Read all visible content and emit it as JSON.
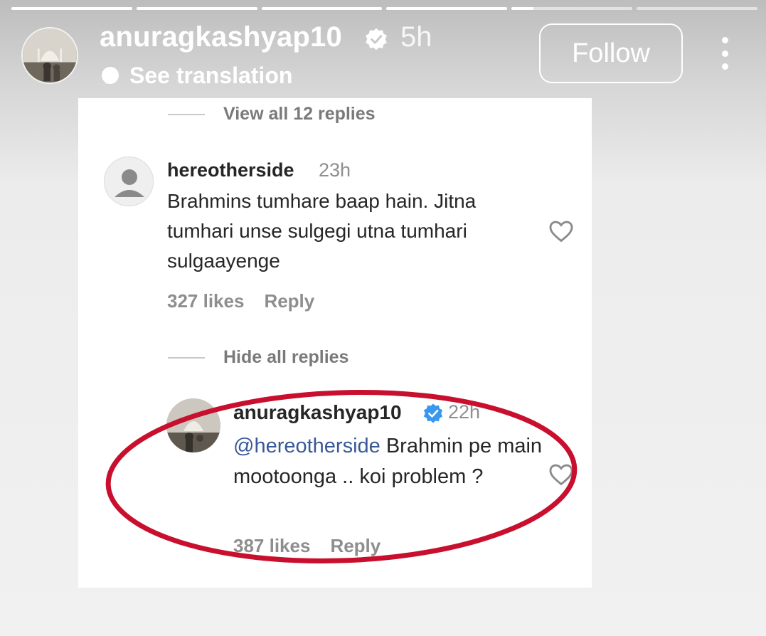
{
  "story": {
    "progress": [
      1,
      1,
      1,
      1,
      0.18,
      0
    ],
    "header": {
      "username": "anuragkashyap10",
      "time": "5h",
      "translation": "See translation",
      "follow_label": "Follow"
    }
  },
  "screenshot": {
    "view_replies": "View all 12 replies",
    "comment1": {
      "username": "hereotherside",
      "time": "23h",
      "text": "Brahmins tumhare baap hain. Jitna tumhari unse sulgegi utna tumhari sulgaayenge",
      "likes": "327 likes",
      "reply": "Reply"
    },
    "hide_replies": "Hide all replies",
    "comment2": {
      "username": "anuragkashyap10",
      "time": "22h",
      "mention": "@hereotherside",
      "text": " Brahmin pe main mootoonga .. koi problem ?",
      "likes": "387 likes",
      "reply": "Reply"
    }
  },
  "colors": {
    "verified": "#3897f0",
    "annotation": "#c8102e",
    "mention": "#385898"
  }
}
